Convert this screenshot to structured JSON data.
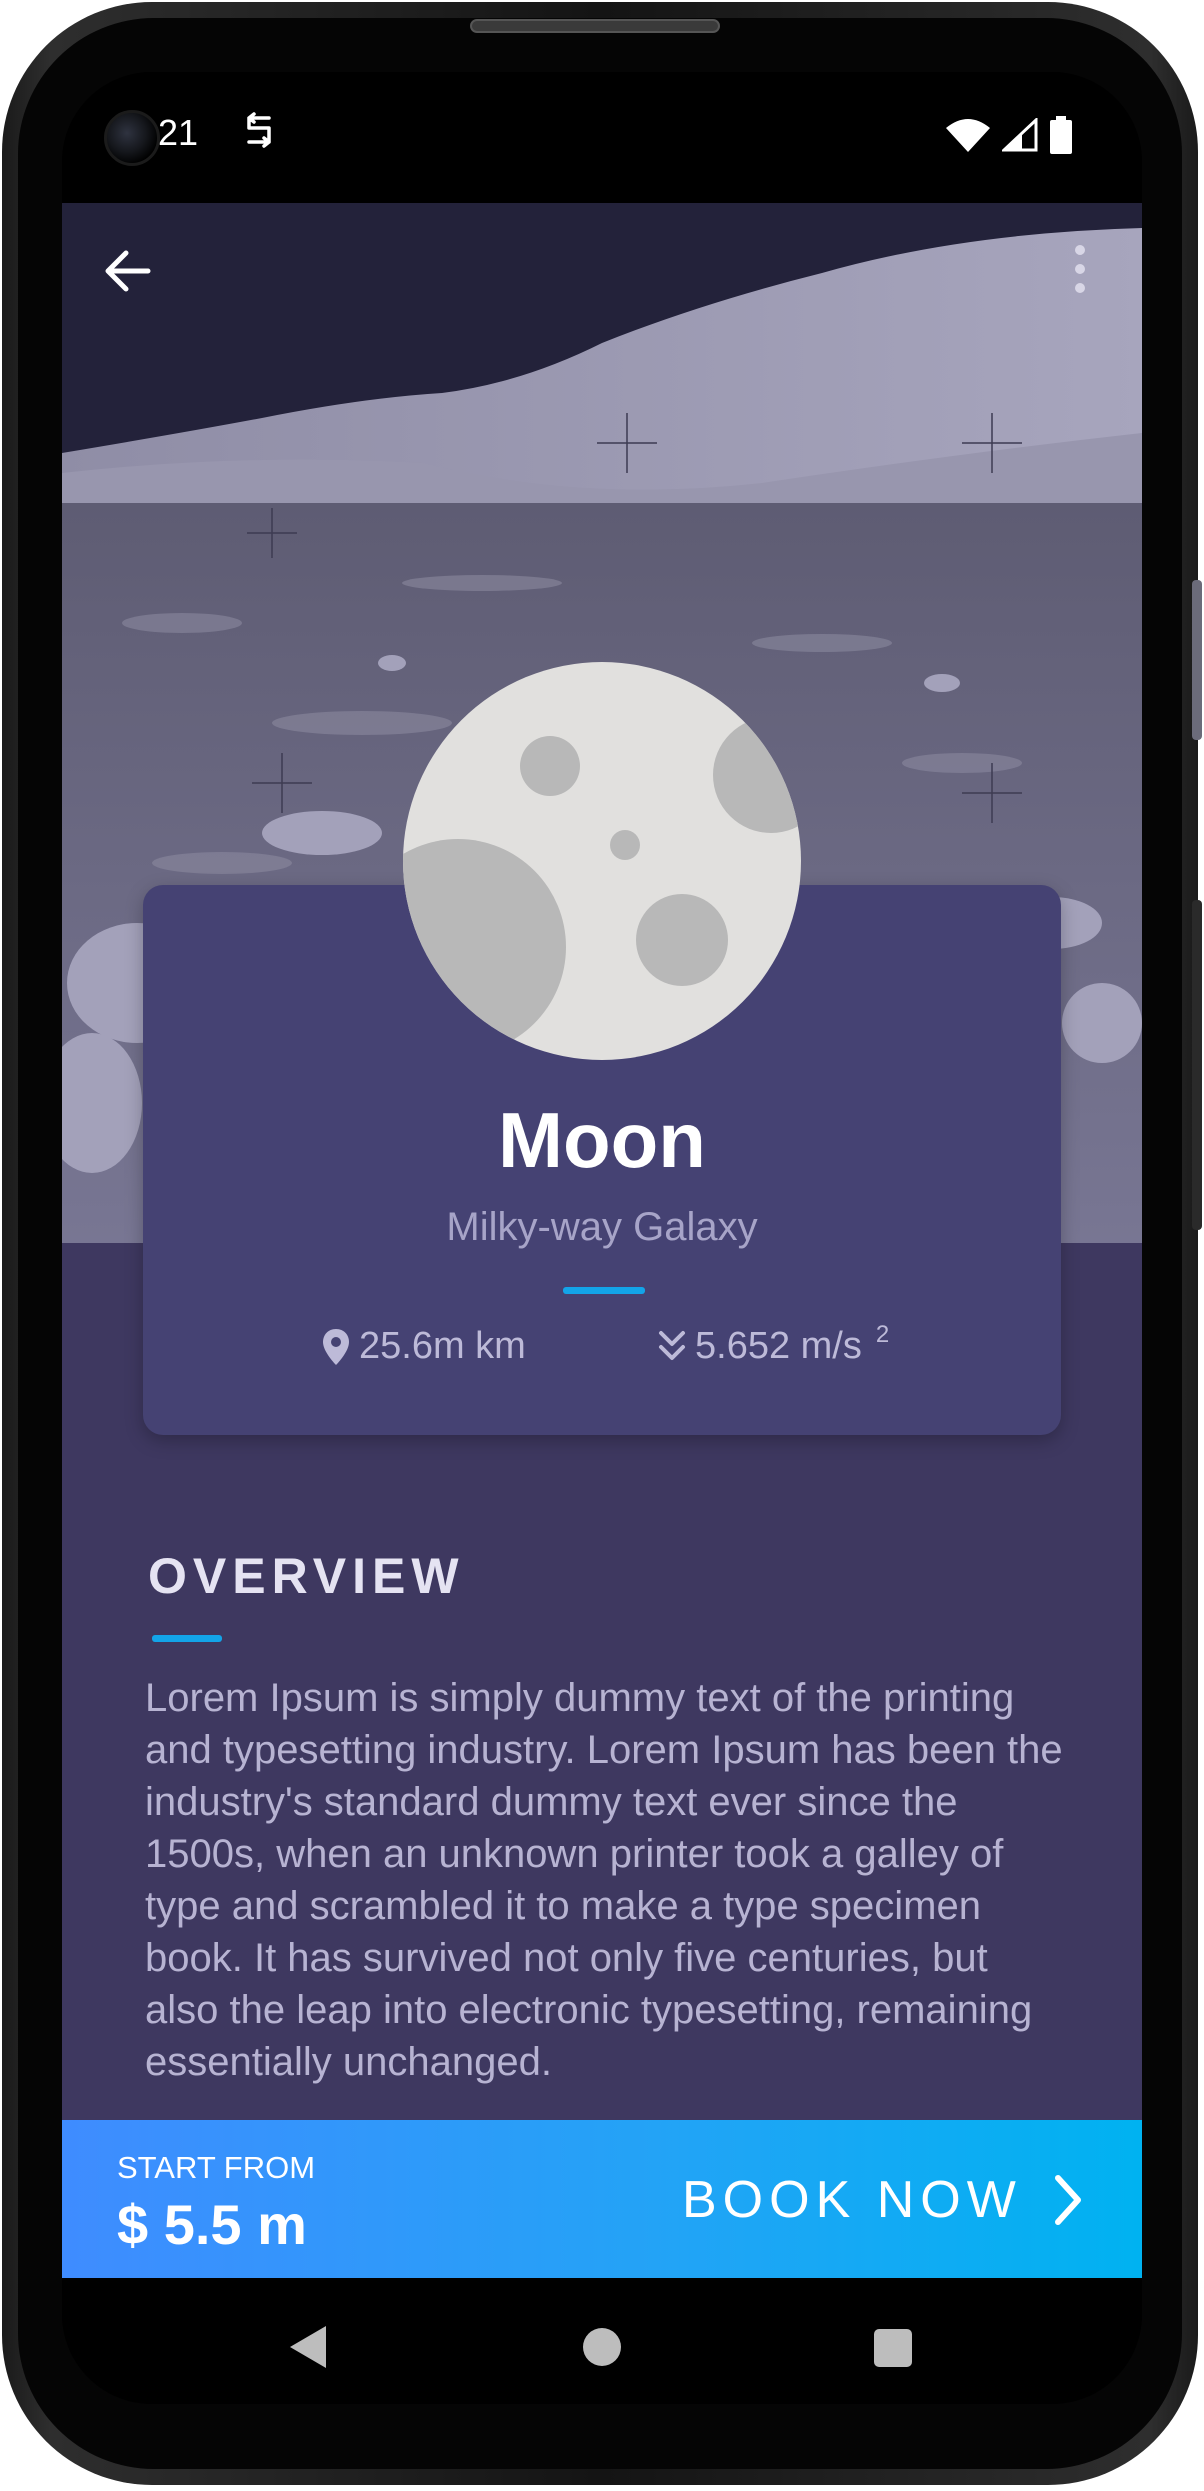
{
  "status_bar": {
    "time": "21",
    "icons": [
      "sync-icon",
      "wifi-icon",
      "cellular-signal-icon",
      "battery-icon"
    ]
  },
  "app_bar": {
    "back_icon": "arrow-left-icon",
    "menu_icon": "more-vertical-icon"
  },
  "planet": {
    "name": "Moon",
    "galaxy": "Milky-way Galaxy",
    "distance": "25.6m km",
    "gravity": "5.652 m/s",
    "gravity_exponent": "2",
    "distance_icon": "location-pin-icon",
    "gravity_icon": "double-chevron-down-icon"
  },
  "overview": {
    "title": "OVERVIEW",
    "text": "Lorem Ipsum is simply dummy text of the printing and typesetting industry. Lorem Ipsum has been the industry's standard dummy text ever since the 1500s, when an unknown printer took a galley of type and scrambled it to make a type specimen book. It has survived not only five centuries, but also the leap into electronic typesetting, remaining essentially unchanged."
  },
  "booking": {
    "start_label": "START FROM",
    "price": "$ 5.5 m",
    "button_label": "BOOK NOW",
    "button_icon": "chevron-right-icon"
  },
  "nav_bar": {
    "icons": [
      "nav-back-icon",
      "nav-home-icon",
      "nav-recents-icon"
    ]
  },
  "colors": {
    "accent": "#13a4e8",
    "card": "#454273",
    "content_bg": "#3e3860",
    "cta_start": "#3f8cff",
    "cta_end": "#00b2f1"
  }
}
